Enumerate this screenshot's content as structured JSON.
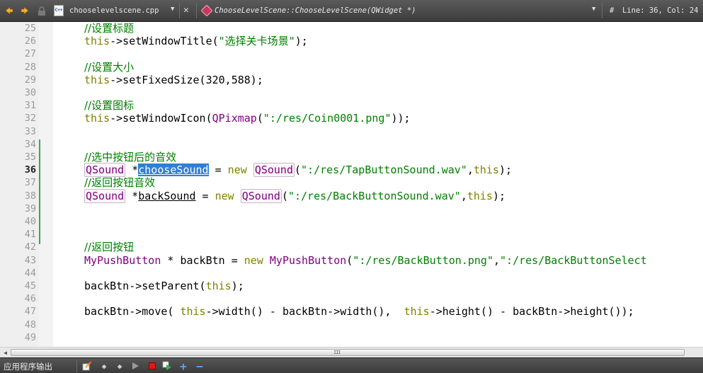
{
  "toolbar": {
    "filename": "chooselevelscene.cpp",
    "file_icon_label": "C++",
    "symbol": "ChooseLevelScene::ChooseLevelScene(QWidget *)",
    "hash": "#",
    "line_col": "Line: 36, Col: 24",
    "dropdown_glyph": "▼",
    "close_glyph": "✕"
  },
  "editor": {
    "current_line": 36,
    "lines": [
      {
        "n": "25",
        "tokens": [
          {
            "t": "//设置标题",
            "c": "cm"
          }
        ]
      },
      {
        "n": "26",
        "tokens": [
          {
            "t": "this",
            "c": "kw"
          },
          {
            "t": "->setWindowTitle(",
            "c": ""
          },
          {
            "t": "\"选择关卡场景\"",
            "c": "str"
          },
          {
            "t": ");",
            "c": ""
          }
        ]
      },
      {
        "n": "27",
        "tokens": []
      },
      {
        "n": "28",
        "tokens": [
          {
            "t": "//设置大小",
            "c": "cm"
          }
        ]
      },
      {
        "n": "29",
        "tokens": [
          {
            "t": "this",
            "c": "kw"
          },
          {
            "t": "->setFixedSize(320,588);",
            "c": ""
          }
        ]
      },
      {
        "n": "30",
        "tokens": []
      },
      {
        "n": "31",
        "tokens": [
          {
            "t": "//设置图标",
            "c": "cm"
          }
        ]
      },
      {
        "n": "32",
        "tokens": [
          {
            "t": "this",
            "c": "kw"
          },
          {
            "t": "->setWindowIcon(",
            "c": ""
          },
          {
            "t": "QPixmap",
            "c": "type"
          },
          {
            "t": "(",
            "c": ""
          },
          {
            "t": "\":/res/Coin0001.png\"",
            "c": "str"
          },
          {
            "t": "));",
            "c": ""
          }
        ]
      },
      {
        "n": "33",
        "tokens": []
      },
      {
        "n": "34",
        "tokens": []
      },
      {
        "n": "35",
        "tokens": [
          {
            "t": "//选中按钮后的音效",
            "c": "cm"
          }
        ]
      },
      {
        "n": "36",
        "tokens": [
          {
            "t": "QSound",
            "c": "type boxed"
          },
          {
            "t": " *",
            "c": ""
          },
          {
            "t": "chooseSound",
            "c": "sel"
          },
          {
            "t": " = ",
            "c": ""
          },
          {
            "t": "new",
            "c": "kw"
          },
          {
            "t": " ",
            "c": ""
          },
          {
            "t": "QSound",
            "c": "type boxed"
          },
          {
            "t": "(",
            "c": ""
          },
          {
            "t": "\":/res/TapButtonSound.wav\"",
            "c": "str"
          },
          {
            "t": ",",
            "c": ""
          },
          {
            "t": "this",
            "c": "kw"
          },
          {
            "t": ");",
            "c": ""
          }
        ]
      },
      {
        "n": "37",
        "tokens": [
          {
            "t": "//返回按钮音效",
            "c": "cm"
          }
        ]
      },
      {
        "n": "38",
        "tokens": [
          {
            "t": "QSound",
            "c": "type boxed"
          },
          {
            "t": " *",
            "c": ""
          },
          {
            "t": "backSound",
            "c": "ul"
          },
          {
            "t": " = ",
            "c": ""
          },
          {
            "t": "new",
            "c": "kw"
          },
          {
            "t": " ",
            "c": ""
          },
          {
            "t": "QSound",
            "c": "type boxed"
          },
          {
            "t": "(",
            "c": ""
          },
          {
            "t": "\":/res/BackButtonSound.wav\"",
            "c": "str"
          },
          {
            "t": ",",
            "c": ""
          },
          {
            "t": "this",
            "c": "kw"
          },
          {
            "t": ");",
            "c": ""
          }
        ]
      },
      {
        "n": "39",
        "tokens": []
      },
      {
        "n": "40",
        "tokens": []
      },
      {
        "n": "41",
        "tokens": []
      },
      {
        "n": "42",
        "tokens": [
          {
            "t": "//返回按钮",
            "c": "cm"
          }
        ]
      },
      {
        "n": "43",
        "tokens": [
          {
            "t": "MyPushButton",
            "c": "type"
          },
          {
            "t": " * backBtn = ",
            "c": ""
          },
          {
            "t": "new",
            "c": "kw"
          },
          {
            "t": " ",
            "c": ""
          },
          {
            "t": "MyPushButton",
            "c": "type"
          },
          {
            "t": "(",
            "c": ""
          },
          {
            "t": "\":/res/BackButton.png\"",
            "c": "str"
          },
          {
            "t": ",",
            "c": ""
          },
          {
            "t": "\":/res/BackButtonSelect",
            "c": "str"
          }
        ]
      },
      {
        "n": "44",
        "tokens": []
      },
      {
        "n": "45",
        "tokens": [
          {
            "t": "backBtn->setParent(",
            "c": ""
          },
          {
            "t": "this",
            "c": "kw"
          },
          {
            "t": ");",
            "c": ""
          }
        ]
      },
      {
        "n": "46",
        "tokens": []
      },
      {
        "n": "47",
        "tokens": [
          {
            "t": "backBtn->move( ",
            "c": ""
          },
          {
            "t": "this",
            "c": "kw"
          },
          {
            "t": "->width() - backBtn->width(),  ",
            "c": ""
          },
          {
            "t": "this",
            "c": "kw"
          },
          {
            "t": "->height() - backBtn->height());",
            "c": ""
          }
        ]
      },
      {
        "n": "48",
        "tokens": []
      },
      {
        "n": "49",
        "tokens": []
      }
    ]
  },
  "scrollbar": {
    "grip": "III"
  },
  "output_pane": {
    "title": "应用程序输出"
  }
}
